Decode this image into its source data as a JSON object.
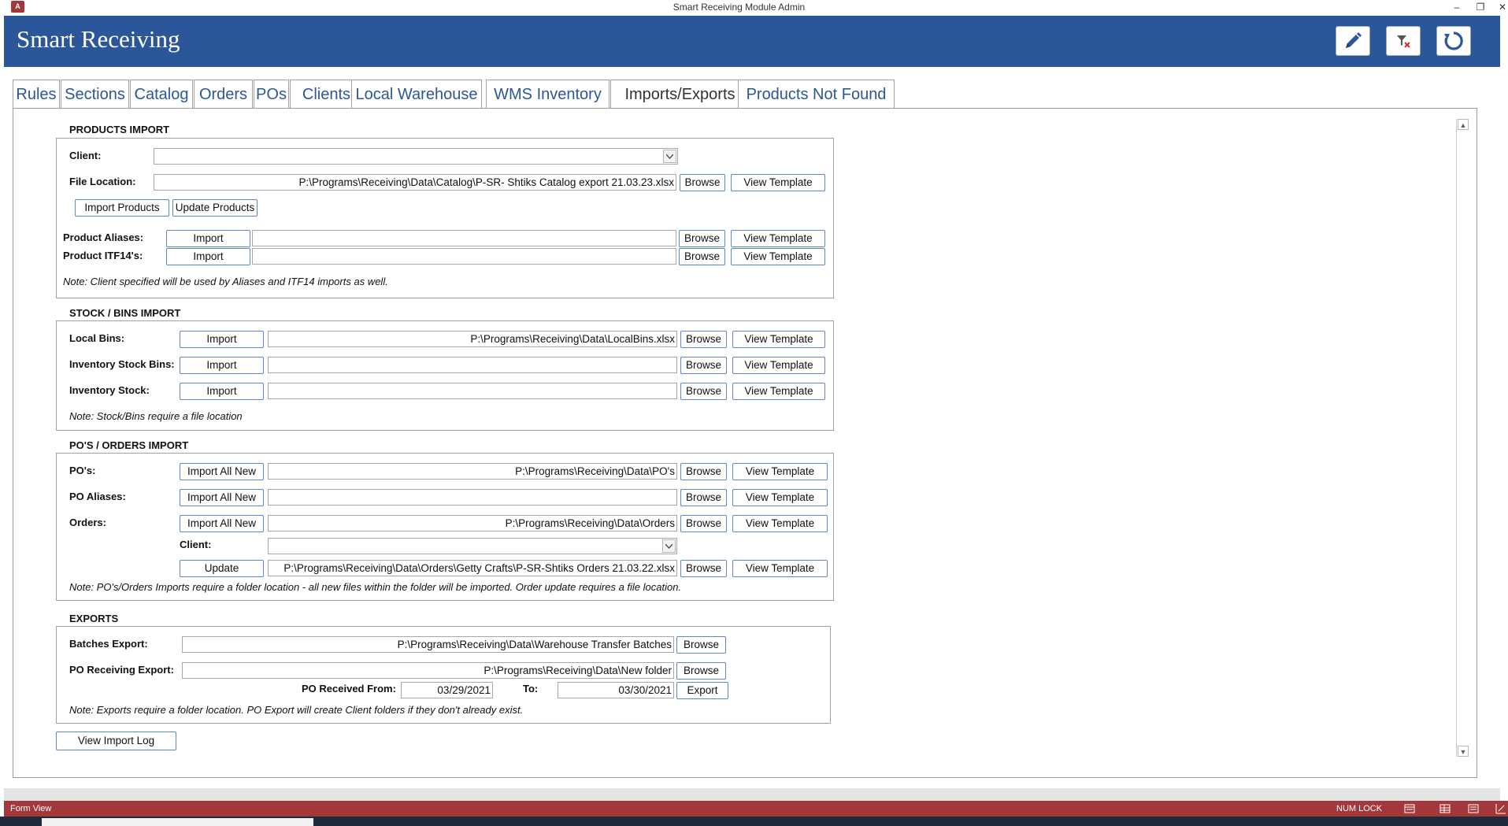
{
  "window": {
    "title": "Smart Receiving Module Admin",
    "app_icon_text": "A",
    "controls": [
      "–",
      "❐",
      "✕"
    ]
  },
  "header": {
    "title": "Smart Receiving",
    "buttons": [
      "pencil-icon",
      "clear-filter-icon",
      "refresh-icon"
    ],
    "colors": {
      "bar": "#2b579a",
      "tab_text": "#2b579a",
      "status_bar": "#a4373a"
    }
  },
  "tabs": [
    {
      "label": "Rules",
      "active": false
    },
    {
      "label": "Sections",
      "active": false
    },
    {
      "label": "Catalog",
      "active": false
    },
    {
      "label": "Orders",
      "active": false
    },
    {
      "label": "POs",
      "active": false
    },
    {
      "label": "Clients",
      "active": false
    },
    {
      "label": "Local Warehouse",
      "active": false
    },
    {
      "label": "WMS Inventory",
      "active": false
    },
    {
      "label": "Imports/Exports",
      "active": true
    },
    {
      "label": "Products Not Found",
      "active": false
    }
  ],
  "products_import": {
    "section_title": "PRODUCTS IMPORT",
    "client_label": "Client:",
    "client_value": "",
    "file_location_label": "File Location:",
    "file_location_value": "P:\\Programs\\Receiving\\Data\\Catalog\\P-SR- Shtiks Catalog export 21.03.23.xlsx",
    "browse": "Browse",
    "view_template": "View Template",
    "import_products": "Import Products",
    "update_products": "Update Products",
    "aliases_label": "Product Aliases:",
    "itf14_label": "Product ITF14's:",
    "import": "Import",
    "note": "Note: Client specified will be used by Aliases and ITF14 imports as well."
  },
  "stock_bins_import": {
    "section_title": "STOCK / BINS IMPORT",
    "local_bins_label": "Local Bins:",
    "local_bins_value": "P:\\Programs\\Receiving\\Data\\LocalBins.xlsx",
    "inventory_stock_bins_label": "Inventory Stock Bins:",
    "inventory_stock_label": "Inventory Stock:",
    "import": "Import",
    "browse": "Browse",
    "view_template": "View Template",
    "note": "Note: Stock/Bins require a file location"
  },
  "po_orders_import": {
    "section_title": "PO'S / ORDERS IMPORT",
    "pos_label": "PO's:",
    "pos_value": "P:\\Programs\\Receiving\\Data\\PO's",
    "po_aliases_label": "PO Aliases:",
    "orders_label": "Orders:",
    "orders_value": "P:\\Programs\\Receiving\\Data\\Orders",
    "client_label": "Client:",
    "update_value": "P:\\Programs\\Receiving\\Data\\Orders\\Getty Crafts\\P-SR-Shtiks Orders 21.03.22.xlsx",
    "import_all_new": "Import All New",
    "update": "Update",
    "browse": "Browse",
    "view_template": "View Template",
    "note": "Note: PO's/Orders Imports require a folder location - all new files within the folder will be imported. Order update requires a file location."
  },
  "exports": {
    "section_title": "EXPORTS",
    "batches_label": "Batches Export:",
    "batches_value": "P:\\Programs\\Receiving\\Data\\Warehouse Transfer Batches",
    "po_receiving_label": "PO Receiving Export:",
    "po_receiving_value": "P:\\Programs\\Receiving\\Data\\New folder",
    "received_from_label": "PO Received From:",
    "received_from_value": "03/29/2021",
    "to_label": "To:",
    "to_value": "03/30/2021",
    "browse": "Browse",
    "export": "Export",
    "note": "Note: Exports require a folder location. PO Export will create Client folders if they don't already exist."
  },
  "view_import_log": "View Import Log",
  "status": {
    "left": "Form View",
    "num_lock": "NUM LOCK"
  }
}
